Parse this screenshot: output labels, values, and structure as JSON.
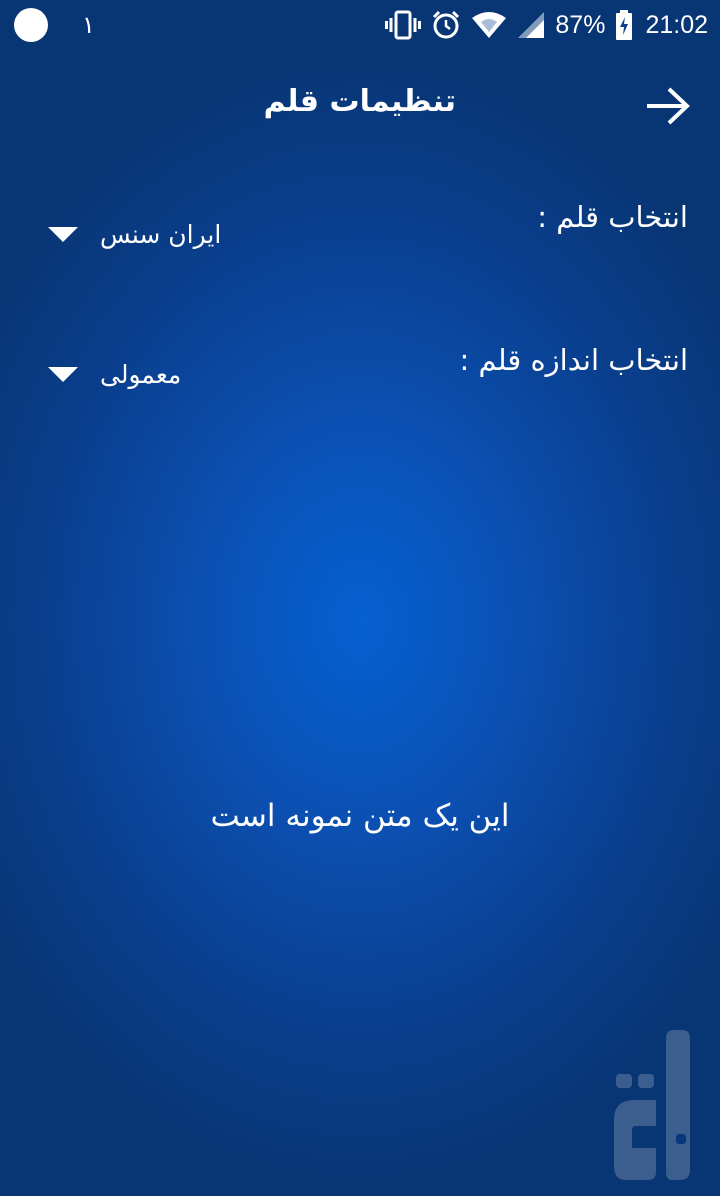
{
  "status_bar": {
    "notification_count": "۱",
    "battery_percent": "87%",
    "time": "21:02",
    "icons": [
      "notification-dot-icon",
      "vibrate-icon",
      "alarm-icon",
      "wifi-icon",
      "signal-icon",
      "battery-charging-icon"
    ]
  },
  "toolbar": {
    "title": "تنظیمات قلم",
    "back_icon": "arrow-right-icon"
  },
  "settings": {
    "font": {
      "label": "انتخاب قلم :",
      "value": "ایران سنس"
    },
    "size": {
      "label": "انتخاب اندازه قلم :",
      "value": "معمولی"
    }
  },
  "sample_text": "این یک متن نمونه است",
  "colors": {
    "background_center": "#0560d2",
    "background_edge": "#083574",
    "text": "#ffffff"
  }
}
